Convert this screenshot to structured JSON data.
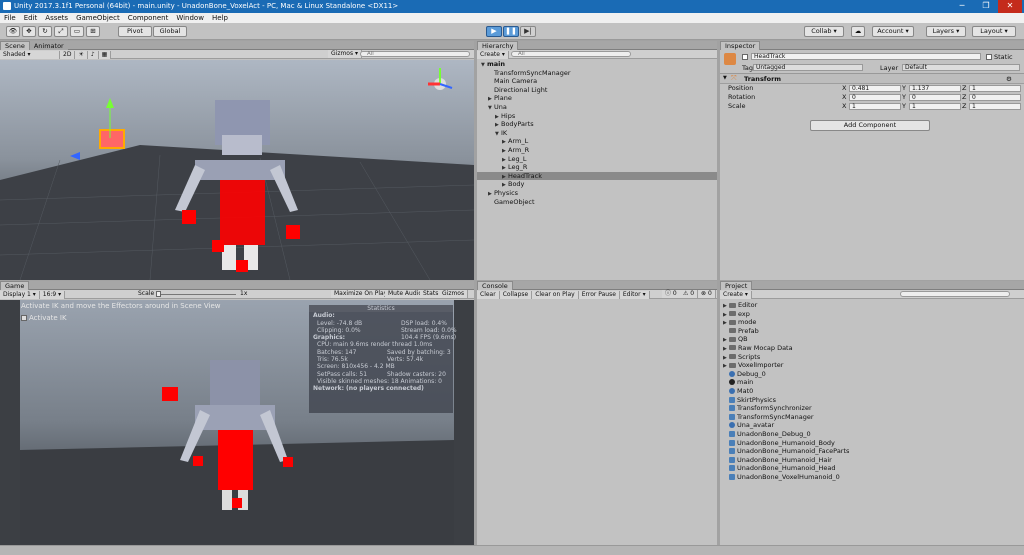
{
  "window": {
    "title": "Unity 2017.3.1f1 Personal (64bit) - main.unity - UnadonBone_VoxelAct - PC, Mac & Linux Standalone <DX11>"
  },
  "menu": [
    "File",
    "Edit",
    "Assets",
    "GameObject",
    "Component",
    "Window",
    "Help"
  ],
  "toolbar": {
    "pivot": "Pivot",
    "global": "Global",
    "collab": "Collab",
    "account": "Account",
    "layers": "Layers",
    "layout": "Layout"
  },
  "scene": {
    "tabs": [
      "Scene",
      "Animator"
    ],
    "shading": "Shaded",
    "mode2d": "2D",
    "gizmos": "Gizmos",
    "search": "All"
  },
  "game": {
    "tab": "Game",
    "display": "Display 1",
    "aspect": "16:9",
    "scale_label": "Scale",
    "scale_value": "1x",
    "buttons": [
      "Maximize On Play",
      "Mute Audio",
      "Stats",
      "Gizmos"
    ],
    "hint": "Activate IK and move the Effectors around in Scene View",
    "activate_ik": "Activate IK"
  },
  "stats": {
    "title": "Statistics",
    "audio": "Audio:",
    "level": "Level: -74.8 dB",
    "dsp": "DSP load: 0.4%",
    "clipping": "Clipping: 0.0%",
    "stream": "Stream load: 0.0%",
    "graphics": "Graphics:",
    "fps": "104.4 FPS (9.6ms)",
    "cpu": "CPU: main 9.6ms  render thread 1.0ms",
    "batches": "Batches: 147",
    "saved": "Saved by batching: 3",
    "tris": "Tris: 76.5k",
    "verts": "Verts: 57.4k",
    "screen": "Screen: 810x456 - 4.2 MB",
    "setpass": "SetPass calls: 51",
    "shadow": "Shadow casters: 20",
    "skinned": "Visible skinned meshes: 18  Animations: 0",
    "network": "Network: (no players connected)"
  },
  "hierarchy": {
    "tab": "Hierarchy",
    "create": "Create",
    "search": "All",
    "items": [
      {
        "label": "main",
        "indent": 0,
        "arrow": "▼"
      },
      {
        "label": "TransformSyncManager",
        "indent": 1,
        "arrow": ""
      },
      {
        "label": "Main Camera",
        "indent": 1,
        "arrow": ""
      },
      {
        "label": "Directional Light",
        "indent": 1,
        "arrow": ""
      },
      {
        "label": "Plane",
        "indent": 1,
        "arrow": "▶"
      },
      {
        "label": "Una",
        "indent": 1,
        "arrow": "▼"
      },
      {
        "label": "Hips",
        "indent": 2,
        "arrow": "▶"
      },
      {
        "label": "BodyParts",
        "indent": 2,
        "arrow": "▶"
      },
      {
        "label": "IK",
        "indent": 2,
        "arrow": "▼"
      },
      {
        "label": "Arm_L",
        "indent": 3,
        "arrow": "▶"
      },
      {
        "label": "Arm_R",
        "indent": 3,
        "arrow": "▶"
      },
      {
        "label": "Leg_L",
        "indent": 3,
        "arrow": "▶"
      },
      {
        "label": "Leg_R",
        "indent": 3,
        "arrow": "▶"
      },
      {
        "label": "HeadTrack",
        "indent": 3,
        "arrow": "▶"
      },
      {
        "label": "Body",
        "indent": 3,
        "arrow": "▶"
      },
      {
        "label": "Physics",
        "indent": 1,
        "arrow": "▶"
      },
      {
        "label": "GameObject",
        "indent": 1,
        "arrow": ""
      }
    ]
  },
  "inspector": {
    "tab": "Inspector",
    "name": "HeadTrack",
    "static": "Static",
    "tag_label": "Tag",
    "tag": "Untagged",
    "layer_label": "Layer",
    "layer": "Default",
    "component": "Transform",
    "position": {
      "label": "Position",
      "x": "0.481",
      "y": "1.137",
      "z": "1"
    },
    "rotation": {
      "label": "Rotation",
      "x": "0",
      "y": "0",
      "z": "0"
    },
    "scale": {
      "label": "Scale",
      "x": "1",
      "y": "1",
      "z": "1"
    },
    "add_component": "Add Component"
  },
  "console": {
    "tab": "Console",
    "buttons": [
      "Clear",
      "Collapse",
      "Clear on Play",
      "Error Pause",
      "Editor"
    ],
    "counts": [
      "0",
      "0",
      "0"
    ]
  },
  "project": {
    "tab": "Project",
    "create": "Create",
    "items": [
      {
        "label": "Editor",
        "type": "folder",
        "arrow": "▶"
      },
      {
        "label": "exp",
        "type": "folder",
        "arrow": "▶"
      },
      {
        "label": "mode",
        "type": "folder",
        "arrow": "▶"
      },
      {
        "label": "Prefab",
        "type": "folder",
        "arrow": ""
      },
      {
        "label": "QB",
        "type": "folder",
        "arrow": "▶"
      },
      {
        "label": "Raw Mocap Data",
        "type": "folder",
        "arrow": "▶"
      },
      {
        "label": "Scripts",
        "type": "folder",
        "arrow": "▶"
      },
      {
        "label": "VoxelImporter",
        "type": "folder",
        "arrow": "▶"
      },
      {
        "label": "Debug_0",
        "type": "asset",
        "arrow": ""
      },
      {
        "label": "main",
        "type": "unity",
        "arrow": ""
      },
      {
        "label": "Mat0",
        "type": "asset",
        "arrow": ""
      },
      {
        "label": "SkirtPhysics",
        "type": "script",
        "arrow": ""
      },
      {
        "label": "TransformSynchronizer",
        "type": "script",
        "arrow": ""
      },
      {
        "label": "TransformSyncManager",
        "type": "script",
        "arrow": ""
      },
      {
        "label": "Una_avatar",
        "type": "asset",
        "arrow": ""
      },
      {
        "label": "UnadonBone_Debug_0",
        "type": "script",
        "arrow": ""
      },
      {
        "label": "UnadonBone_Humanoid_Body",
        "type": "script",
        "arrow": ""
      },
      {
        "label": "UnadonBone_Humanoid_FaceParts",
        "type": "script",
        "arrow": ""
      },
      {
        "label": "UnadonBone_Humanoid_Hair",
        "type": "script",
        "arrow": ""
      },
      {
        "label": "UnadonBone_Humanoid_Head",
        "type": "script",
        "arrow": ""
      },
      {
        "label": "UnadonBone_VoxelHumanoid_0",
        "type": "script",
        "arrow": ""
      }
    ]
  }
}
